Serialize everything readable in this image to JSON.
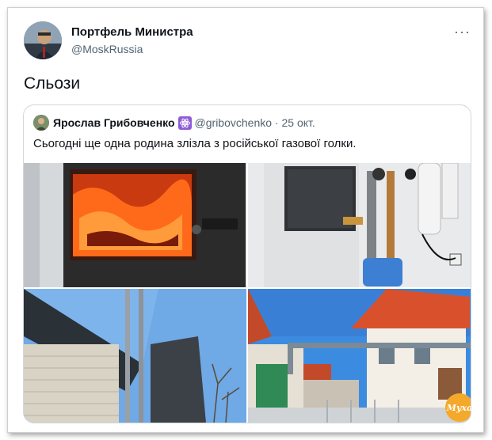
{
  "tweet": {
    "author": "Портфель Министра",
    "handle": "@MoskRussia",
    "more": "···",
    "text": "Сльози"
  },
  "quote": {
    "author": "Ярослав Грибовченко",
    "verified_icon": "atom-icon",
    "handle": "@gribovchenko",
    "separator": " · ",
    "date": "25 окт.",
    "text": "Сьогодні ще одна родина злізла з російської газової голки."
  },
  "media": [
    {
      "name": "furnace-fire-photo"
    },
    {
      "name": "gas-boiler-photo"
    },
    {
      "name": "chimney-house-photo"
    },
    {
      "name": "house-gas-pipe-photo"
    }
  ],
  "watermark": {
    "text": "Муха"
  }
}
